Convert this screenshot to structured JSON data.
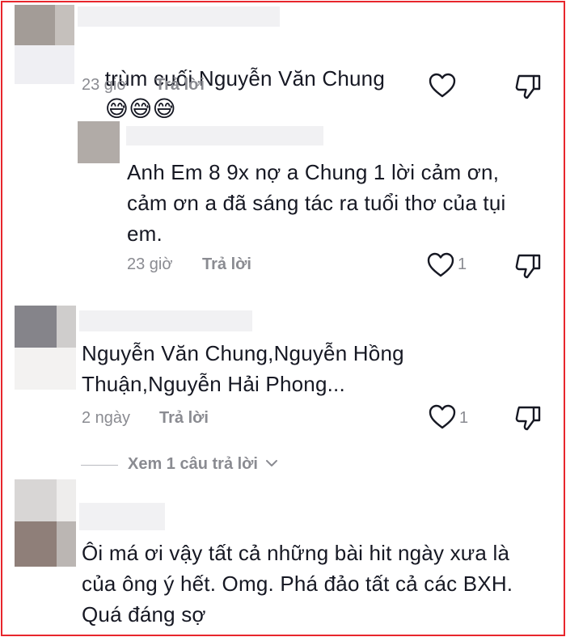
{
  "comments": [
    {
      "text": "trùm cuối Nguyễn Văn Chung",
      "emojis": "😅😅😅",
      "time": "23 giờ",
      "reply_label": "Trả lời",
      "like_count": ""
    },
    {
      "text": "Anh Em 8 9x nợ a Chung 1 lời cảm ơn,\ncảm ơn a đã sáng tác ra tuổi thơ của tụi\nem.",
      "time": "23 giờ",
      "reply_label": "Trả lời",
      "like_count": "1"
    },
    {
      "text": "Nguyễn Văn Chung,Nguyễn Hồng\nThuận,Nguyễn Hải Phong...",
      "time": "2 ngày",
      "reply_label": "Trả lời",
      "like_count": "1",
      "view_more": "Xem 1 câu trả lời"
    },
    {
      "text": "Ôi má ơi vậy tất cả những bài hit ngày xưa là\ncủa ông ý hết. Omg. Phá đảo tất cả các BXH.\nQuá đáng sợ"
    }
  ]
}
